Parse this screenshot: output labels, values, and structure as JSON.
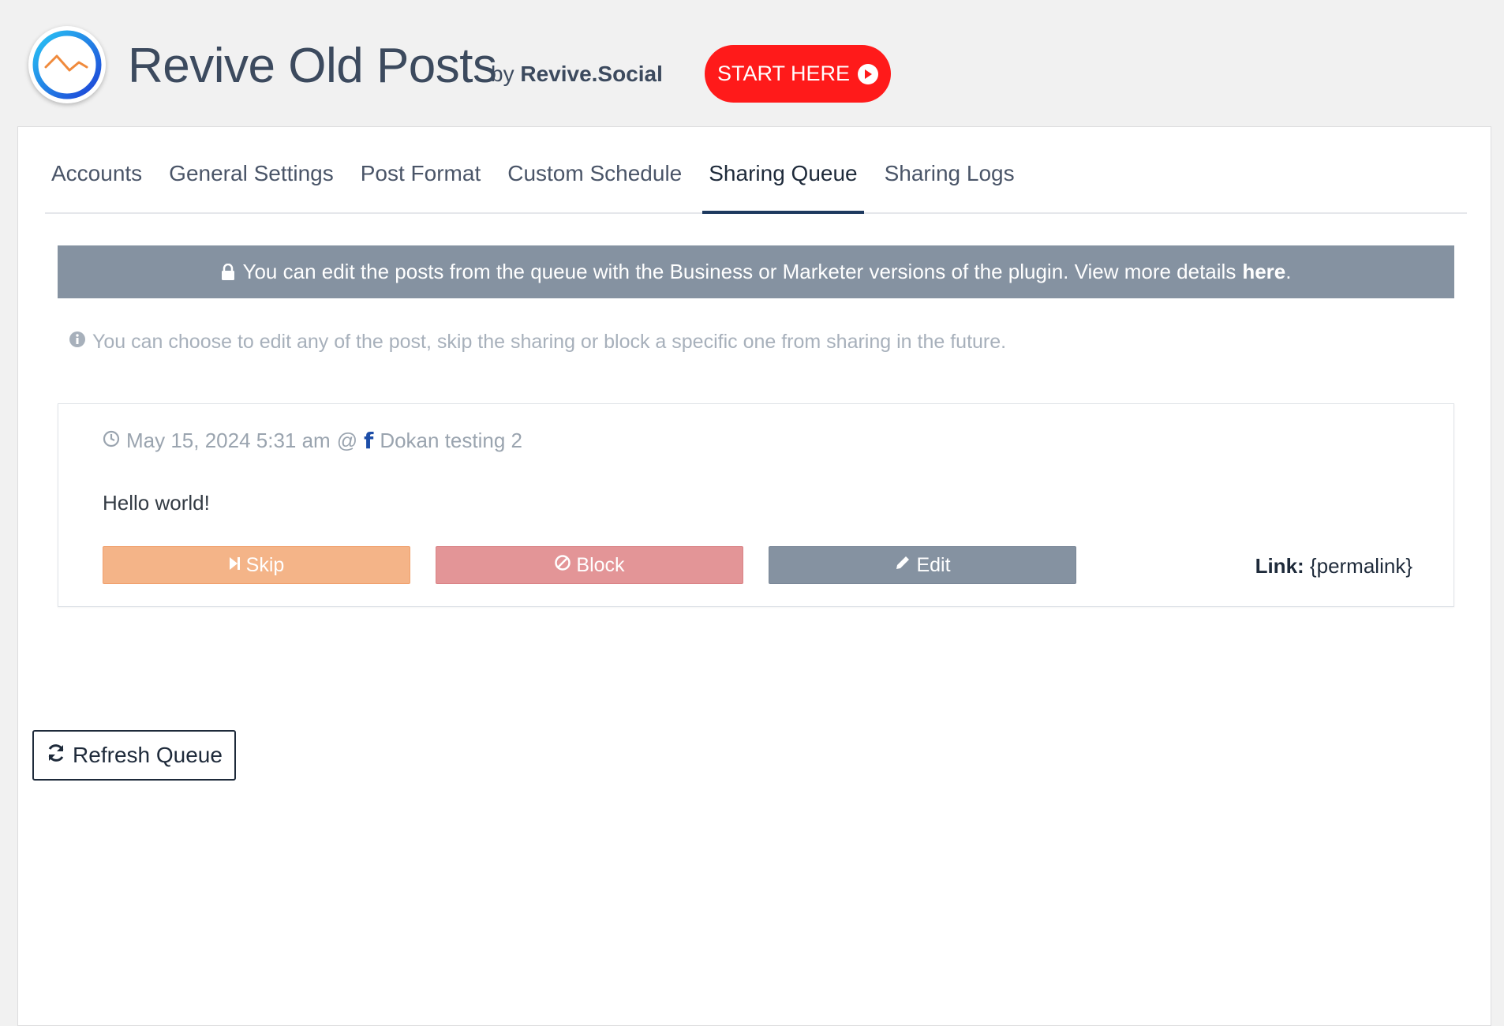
{
  "header": {
    "title": "Revive Old Posts",
    "by_prefix": "by",
    "by_brand": "Revive.Social",
    "start_button": "START HERE"
  },
  "tabs": [
    {
      "label": "Accounts"
    },
    {
      "label": "General Settings"
    },
    {
      "label": "Post Format"
    },
    {
      "label": "Custom Schedule"
    },
    {
      "label": "Sharing Queue",
      "active": true
    },
    {
      "label": "Sharing Logs"
    }
  ],
  "notice": {
    "text": "You can edit the posts from the queue with the Business or Marketer versions of the plugin. View more details",
    "link": "here",
    "suffix": "."
  },
  "info": {
    "text": "You can choose to edit any of the post, skip the sharing or block a specific one from sharing in the future."
  },
  "queue_item": {
    "datetime": "May 15, 2024 5:31 am",
    "at": "@",
    "account": "Dokan testing 2",
    "content": "Hello world!",
    "skip_label": "Skip",
    "block_label": "Block",
    "edit_label": "Edit",
    "link_label": "Link:",
    "link_value": "{permalink}"
  },
  "refresh_button": "Refresh Queue",
  "colors": {
    "start_button": "#ff1a1a",
    "notice_bg": "#8592a1",
    "skip": "#f4b488",
    "block": "#e39597",
    "edit": "#8592a1",
    "active_tab_underline": "#1e3a5f"
  }
}
